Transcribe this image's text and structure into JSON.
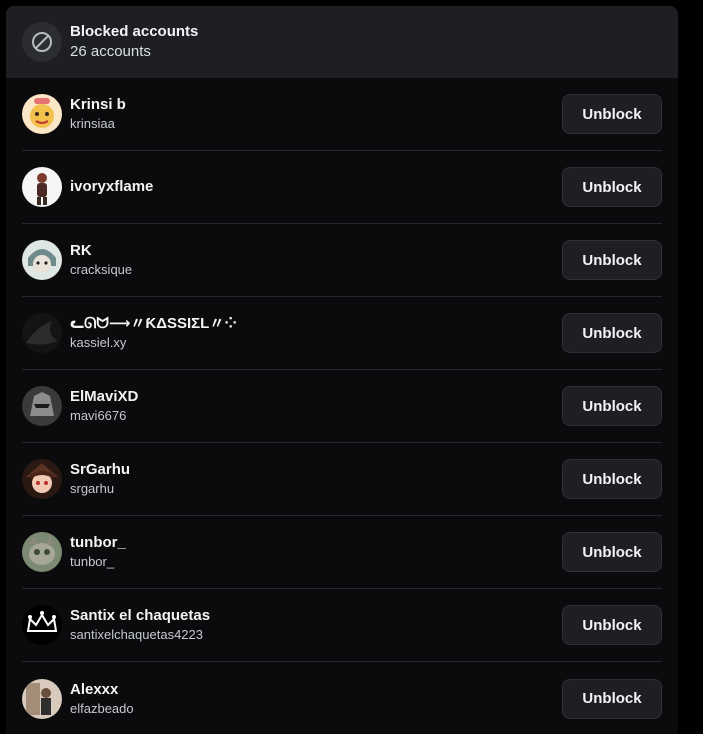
{
  "header": {
    "title": "Blocked accounts",
    "count": "26 accounts",
    "icon": "blocked-icon"
  },
  "button_label": "Unblock",
  "accounts": [
    {
      "display_name": "Krinsi b",
      "username": "krinsiaa",
      "avatar_color": "#f2d27a"
    },
    {
      "display_name": "ivoryxflame",
      "username": "",
      "avatar_color": "#f4f4f4"
    },
    {
      "display_name": "RK",
      "username": "cracksique",
      "avatar_color": "#9aa7a6"
    },
    {
      "display_name": "ᓚᘏᗢ⟶〃ƘΔSSIΣL〃⁘",
      "username": "kassiel.xy",
      "avatar_color": "#1a1a1a"
    },
    {
      "display_name": "ElMaviXD",
      "username": "mavi6676",
      "avatar_color": "#555555"
    },
    {
      "display_name": "SrGarhu",
      "username": "srgarhu",
      "avatar_color": "#5a2f25"
    },
    {
      "display_name": "tunbor_",
      "username": "tunbor_",
      "avatar_color": "#6b7560"
    },
    {
      "display_name": "Santix el chaquetas",
      "username": "santixelchaquetas4223",
      "avatar_color": "#000000"
    },
    {
      "display_name": "Alexxx",
      "username": "elfazbeado",
      "avatar_color": "#b89a80"
    }
  ],
  "colors": {
    "background": "#000000",
    "panel": "#0b0b0d",
    "header": "#1e1f22",
    "button": "#1e1f22",
    "text": "#f2f3f5"
  }
}
